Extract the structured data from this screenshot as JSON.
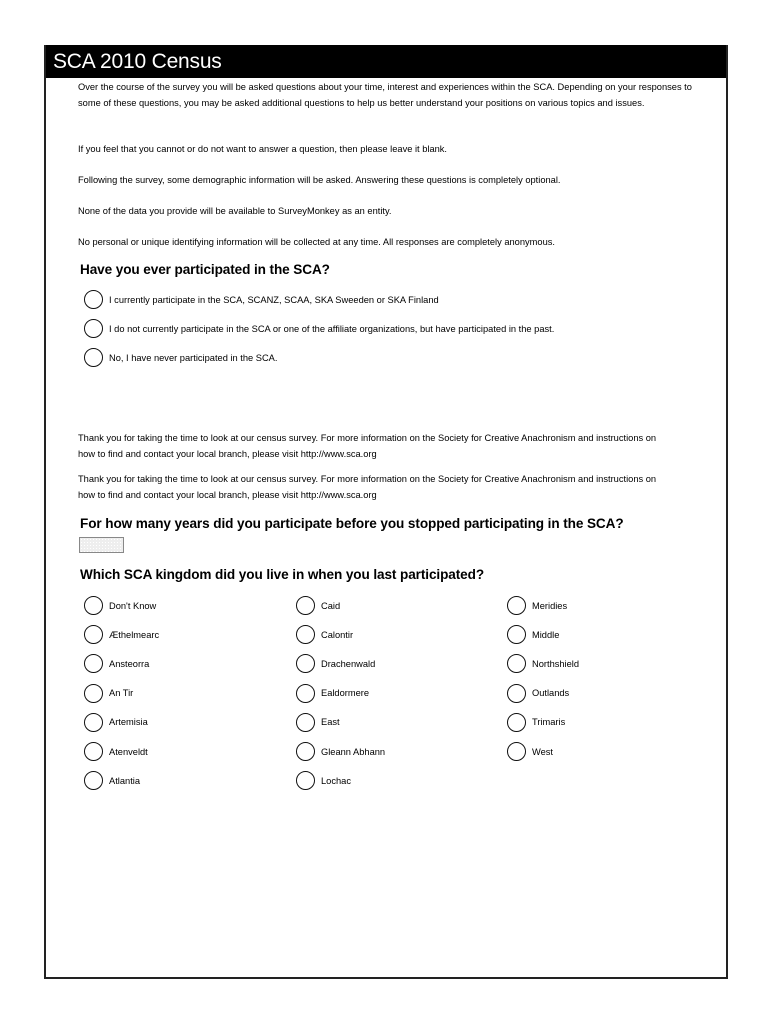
{
  "header": {
    "title": "SCA 2010 Census"
  },
  "intro": {
    "paragraphs": [
      "Over the course of the survey you will be asked questions about your time, interest and experiences within the SCA. Depending on your responses to some of these questions, you may be asked additional questions to help us better understand your positions on various topics and issues.",
      "If you feel that you cannot or do not want to answer a question, then please leave it blank.",
      "Following the survey, some demographic information will be asked. Answering these questions is completely optional.",
      "None of the data you provide will be available to SurveyMonkey as an entity.",
      "No personal or unique identifying information will be collected at any time. All responses are completely anonymous."
    ]
  },
  "q1": {
    "question": "Have you ever participated in the SCA?",
    "options": [
      "I currently participate in the SCA, SCANZ, SCAA, SKA Sweeden or SKA Finland",
      "I do not currently participate in the SCA or one of the affiliate organizations, but have participated in the past.",
      "No, I have never participated in the SCA."
    ]
  },
  "thanks": [
    {
      "line1": "Thank you for taking the time to look at our census survey. For more information on the Society for Creative Anachronism and instructions on",
      "line2": "how to find and contact your local branch, please visit http://www.sca.org"
    },
    {
      "line1": "Thank you for taking the time to look at our census survey. For more information on the Society for Creative Anachronism and instructions on",
      "line2": "how to find and contact your local branch, please visit http://www.sca.org"
    }
  ],
  "q2": {
    "question": "For how many years did you participate before you stopped participating in the SCA?",
    "value": ""
  },
  "q3": {
    "question": "Which SCA kingdom did you live in when you last participated?",
    "columns": [
      [
        "Don't Know",
        "Æthelmearc",
        "Ansteorra",
        "An Tir",
        "Artemisia",
        "Atenveldt",
        "Atlantia"
      ],
      [
        "Caid",
        "Calontir",
        "Drachenwald",
        "Ealdormere",
        "East",
        "Gleann Abhann",
        "Lochac"
      ],
      [
        "Meridies",
        "Middle",
        "Northshield",
        "Outlands",
        "Trimaris",
        "West"
      ]
    ]
  }
}
